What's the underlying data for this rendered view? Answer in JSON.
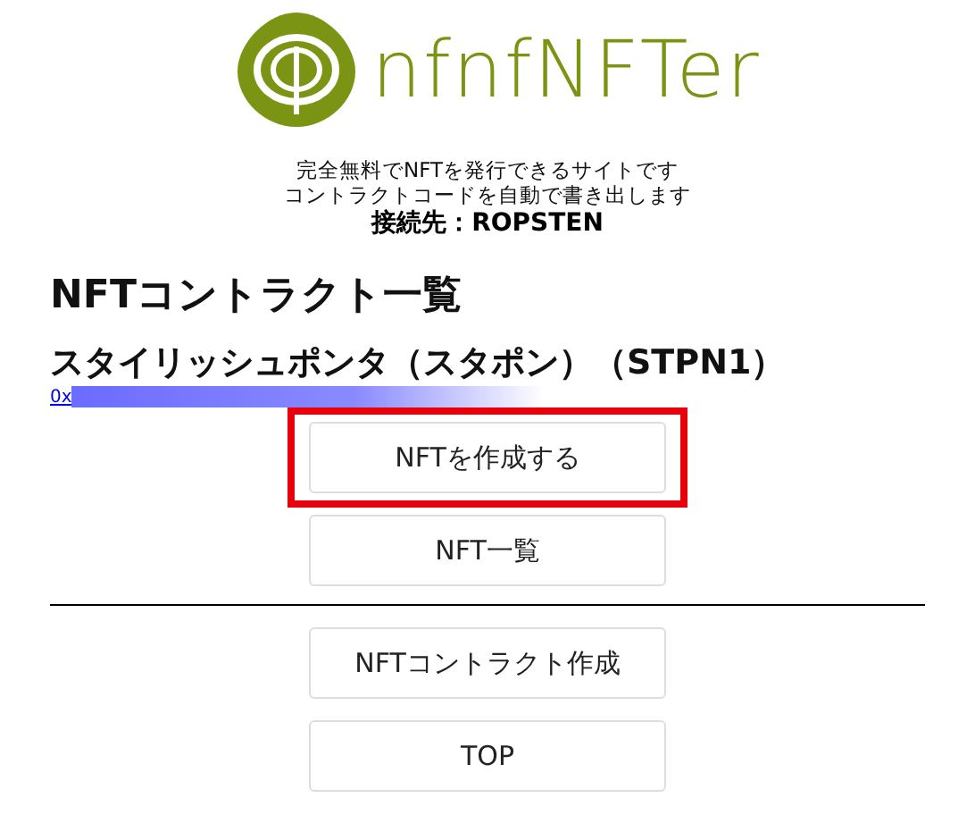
{
  "logo": {
    "text": "nfnfNFTer"
  },
  "tagline": [
    "完全無料でNFTを発行できるサイトです",
    "コントラクトコードを自動で書き出します"
  ],
  "connection": "接続先：ROPSTEN",
  "heading": "NFTコントラクト一覧",
  "contract": {
    "name": "スタイリッシュポンタ（スタポン）（STPN1）",
    "address": "0x"
  },
  "buttons_top": [
    {
      "label": "NFTを作成する",
      "highlighted": true
    },
    {
      "label": "NFT一覧",
      "highlighted": false
    }
  ],
  "buttons_bottom": [
    {
      "label": "NFTコントラクト作成",
      "highlighted": false
    },
    {
      "label": "TOP",
      "highlighted": false
    }
  ]
}
